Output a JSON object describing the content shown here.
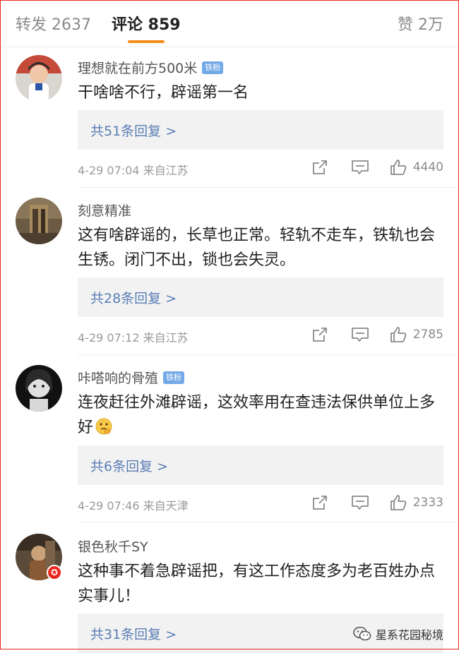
{
  "tabs": {
    "repost": "转发 2637",
    "comments": "评论 859",
    "likes": "赞 2万"
  },
  "comments": [
    {
      "username": "理想就在前方500米",
      "badge": "铁粉",
      "text": "干啥啥不行，辟谣第一名",
      "replies": "共51条回复 >",
      "time_location": "4-29 07:04 来自江苏",
      "likes": "4440"
    },
    {
      "username": "刻意精准",
      "badge": "",
      "text": "这有啥辟谣的，长草也正常。轻轨不走车，铁轨也会生锈。闭门不出，锁也会失灵。",
      "replies": "共28条回复 >",
      "time_location": "4-29 07:12 来自江苏",
      "likes": "2785"
    },
    {
      "username": "咔嗒响的骨殖",
      "badge": "铁粉",
      "text": "连夜赶往外滩辟谣，这效率用在查违法保供单位上多好",
      "emoji": "thinking-face-emoji",
      "replies": "共6条回复 >",
      "time_location": "4-29 07:46 来自天津",
      "likes": "2333"
    },
    {
      "username": "银色秋千SY",
      "badge": "",
      "text": "这种事不着急辟谣把，有这工作态度多为老百姓办点实事儿！",
      "vip_icon": "star-icon",
      "replies": "共31条回复 >"
    }
  ],
  "watermark": {
    "icon": "wechat-icon",
    "text": "星系花园秘境"
  },
  "colors": {
    "accent_underline": "#f58d1d",
    "reply_link": "#5a7eb5",
    "fan_badge": "#73a9e6",
    "frame": "#e8271d"
  }
}
